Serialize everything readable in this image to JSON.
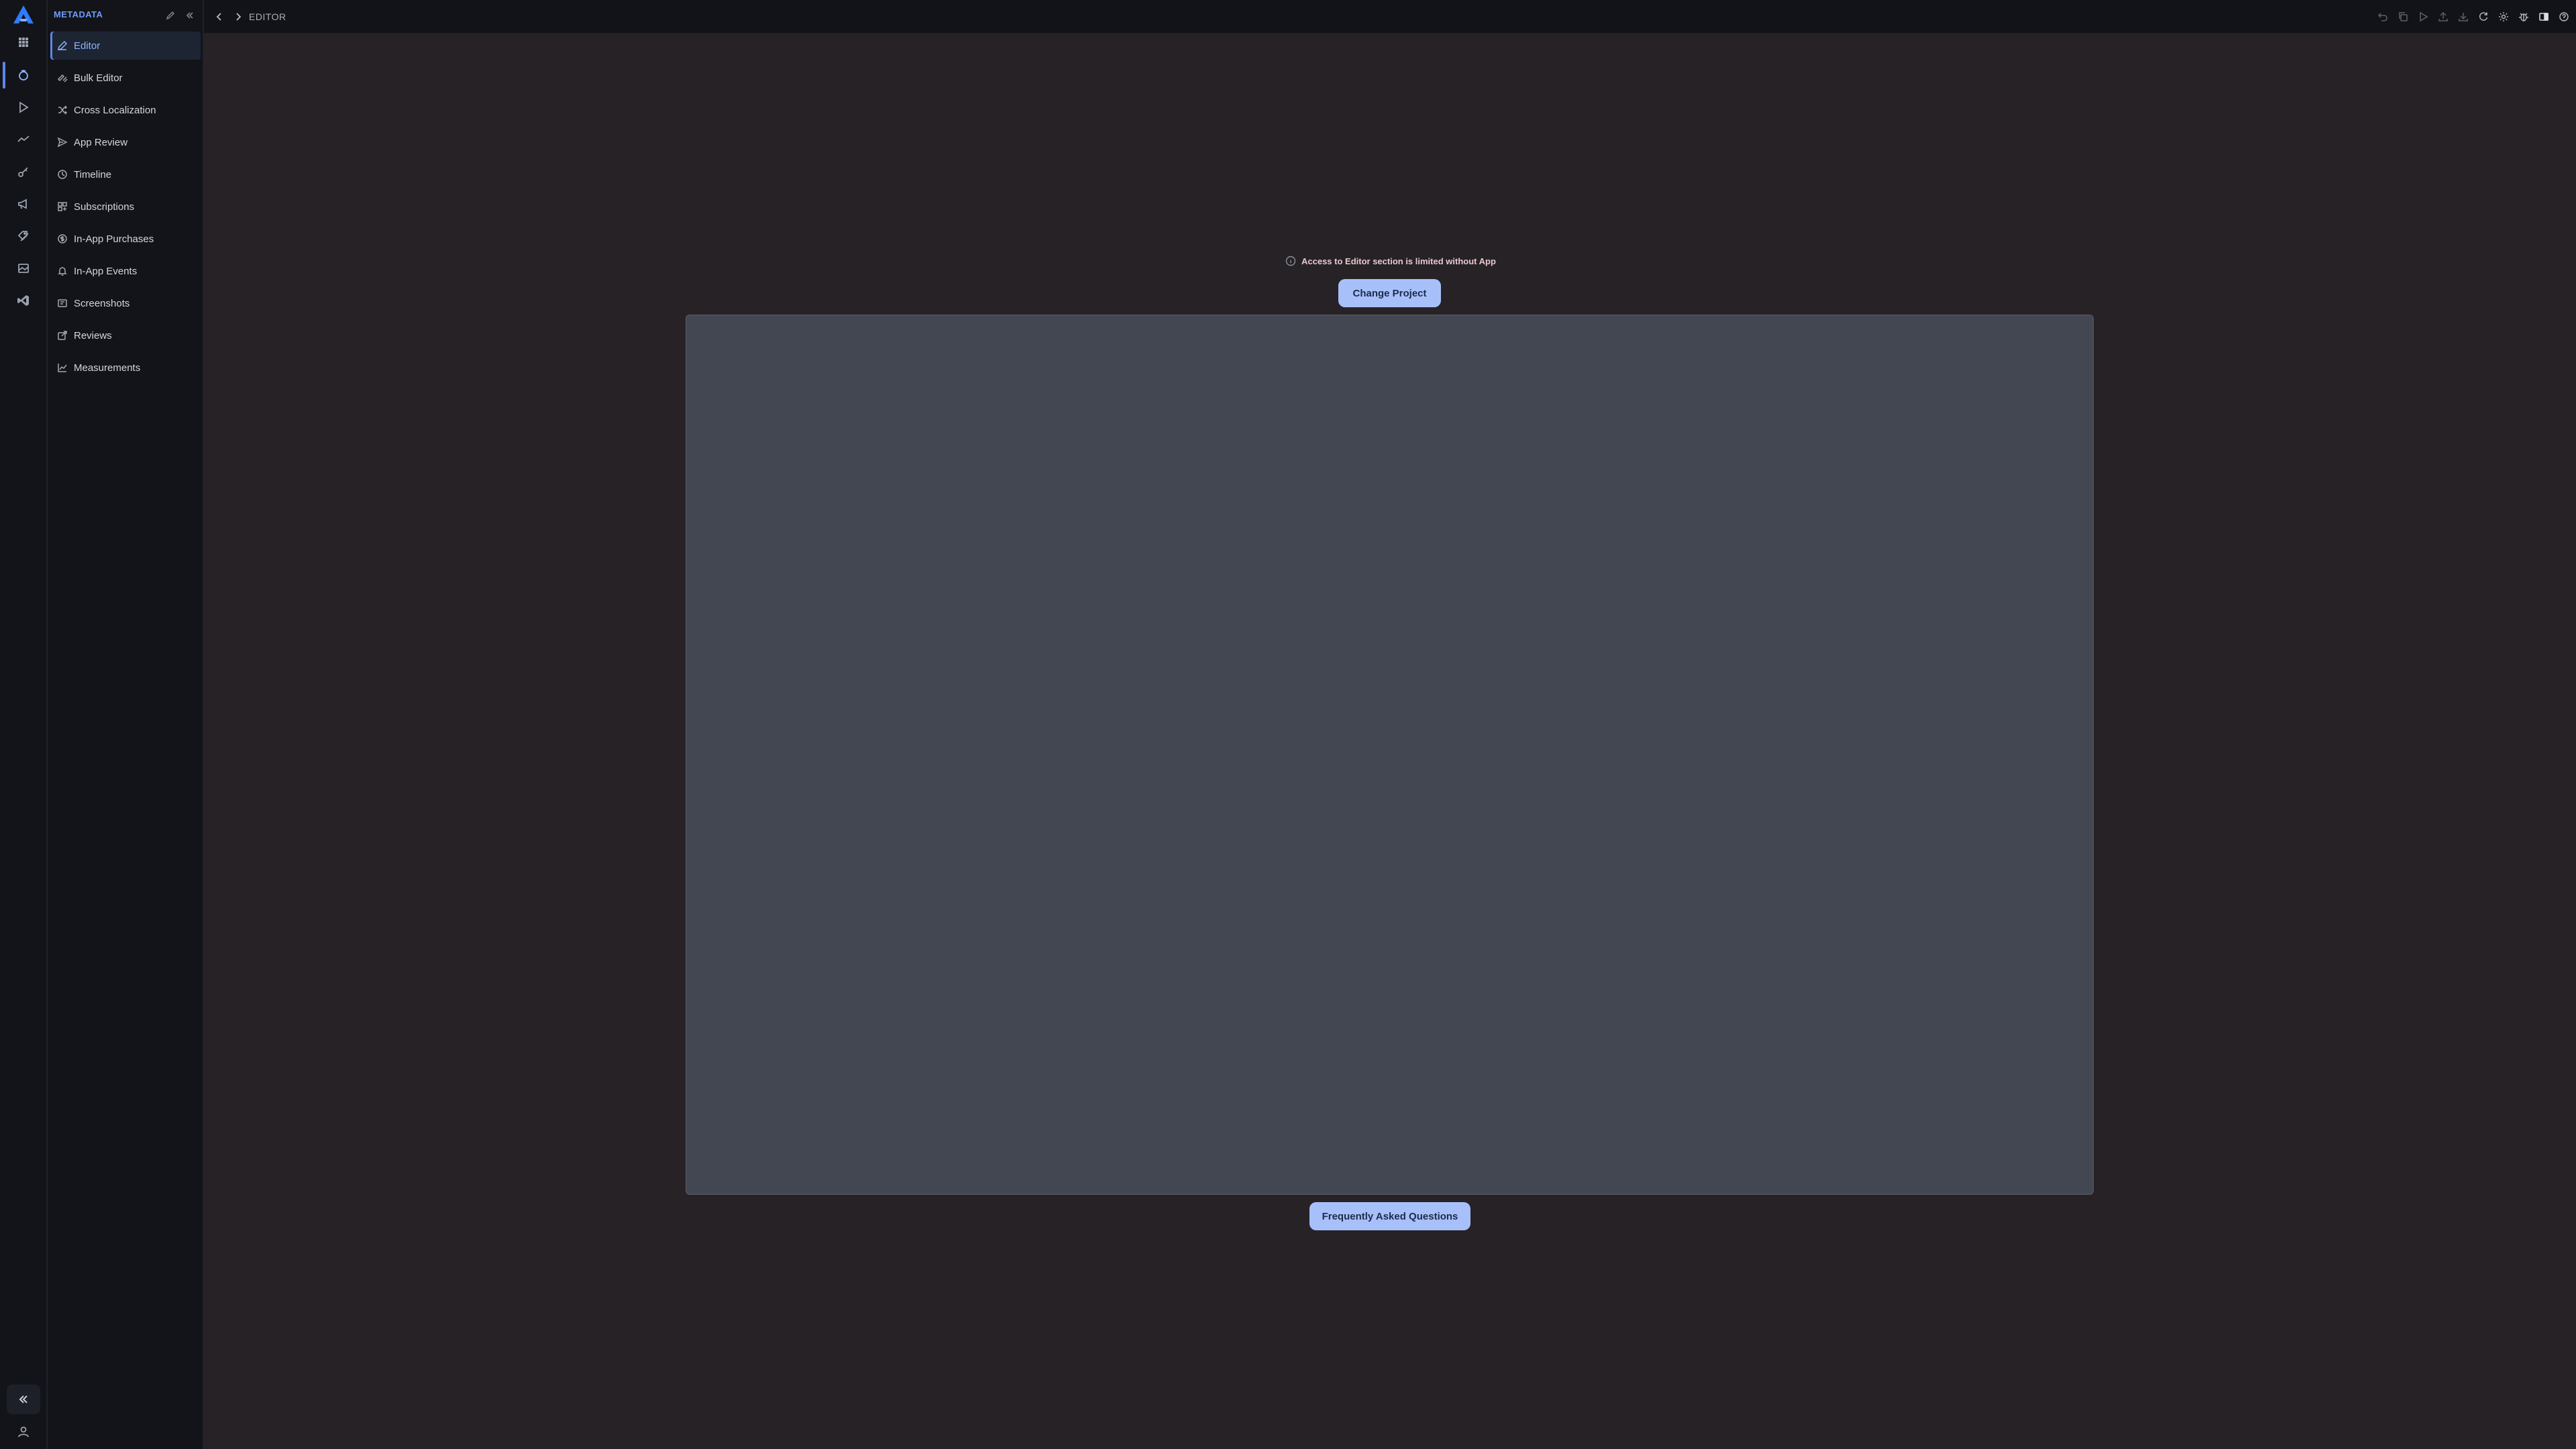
{
  "app": {
    "logo": "a-logo-icon",
    "accent": "#6f9cff",
    "button_color": "#a8c0fa"
  },
  "rail": {
    "items": [
      {
        "name": "grid",
        "icon": "grid-icon"
      },
      {
        "name": "metadata",
        "icon": "app-store-icon",
        "active": true
      },
      {
        "name": "play",
        "icon": "play-icon"
      },
      {
        "name": "analytics",
        "icon": "trend-icon"
      },
      {
        "name": "keys",
        "icon": "key-icon"
      },
      {
        "name": "marketing",
        "icon": "megaphone-icon"
      },
      {
        "name": "tags",
        "icon": "tags-icon"
      },
      {
        "name": "gallery",
        "icon": "image-icon"
      },
      {
        "name": "vscode",
        "icon": "code-icon"
      }
    ],
    "collapse_icon": "double-chevron-left-icon",
    "user_icon": "user-icon"
  },
  "sidebar": {
    "title": "METADATA",
    "items": [
      {
        "label": "Editor",
        "icon": "pen-icon",
        "active": true
      },
      {
        "label": "Bulk Editor",
        "icon": "multi-pen-icon"
      },
      {
        "label": "Cross Localization",
        "icon": "shuffle-icon"
      },
      {
        "label": "App Review",
        "icon": "send-icon"
      },
      {
        "label": "Timeline",
        "icon": "clock-icon"
      },
      {
        "label": "Subscriptions",
        "icon": "subscriptions-icon"
      },
      {
        "label": "In-App Purchases",
        "icon": "coin-icon"
      },
      {
        "label": "In-App Events",
        "icon": "bell-icon"
      },
      {
        "label": "Screenshots",
        "icon": "screenshots-icon"
      },
      {
        "label": "Reviews",
        "icon": "reviews-icon"
      },
      {
        "label": "Measurements",
        "icon": "chart-icon"
      }
    ]
  },
  "topbar": {
    "breadcrumb": "EDITOR",
    "tools": [
      "undo-icon",
      "copy-icon",
      "play-outline-icon",
      "upload-icon",
      "download-icon",
      "refresh-icon",
      "settings-icon",
      "bug-icon",
      "panel-icon",
      "help-icon"
    ]
  },
  "main": {
    "notice": "Access to Editor section is limited without App",
    "change_project_label": "Change Project",
    "faq_label": "Frequently Asked Questions"
  }
}
